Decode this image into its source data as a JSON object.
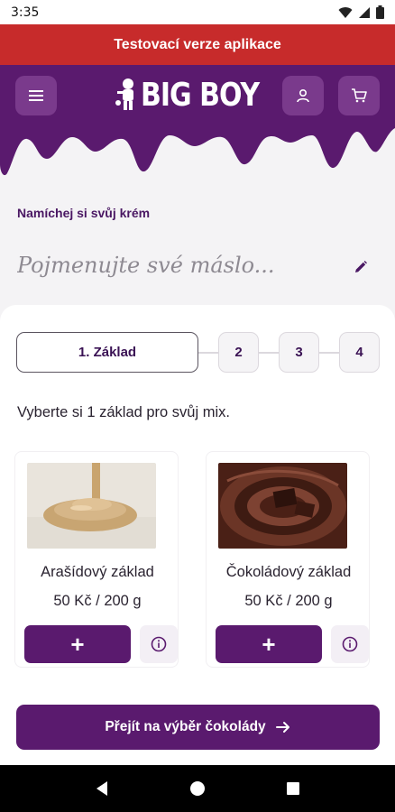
{
  "status_bar": {
    "time": "3:35"
  },
  "banner": {
    "text": "Testovací verze aplikace"
  },
  "header": {
    "logo_text": "BIG BOY",
    "colors": {
      "primary": "#5a1a6e",
      "button": "#7a3a8c"
    }
  },
  "builder": {
    "section_label": "Namíchej si svůj krém",
    "name_placeholder": "Pojmenujte své máslo...",
    "steps": [
      {
        "label": "1. Základ",
        "active": true
      },
      {
        "label": "2",
        "active": false
      },
      {
        "label": "3",
        "active": false
      },
      {
        "label": "4",
        "active": false
      }
    ],
    "instruction": "Vyberte si 1 základ pro svůj mix.",
    "products": [
      {
        "name": "Arašídový základ",
        "price": "50 Kč / 200 g",
        "add_label": "+",
        "image": "peanut-butter-image"
      },
      {
        "name": "Čokoládový základ",
        "price": "50 Kč / 200 g",
        "add_label": "+",
        "image": "chocolate-swirl-image"
      }
    ],
    "cta_label": "Přejít na výběr čokolády"
  }
}
